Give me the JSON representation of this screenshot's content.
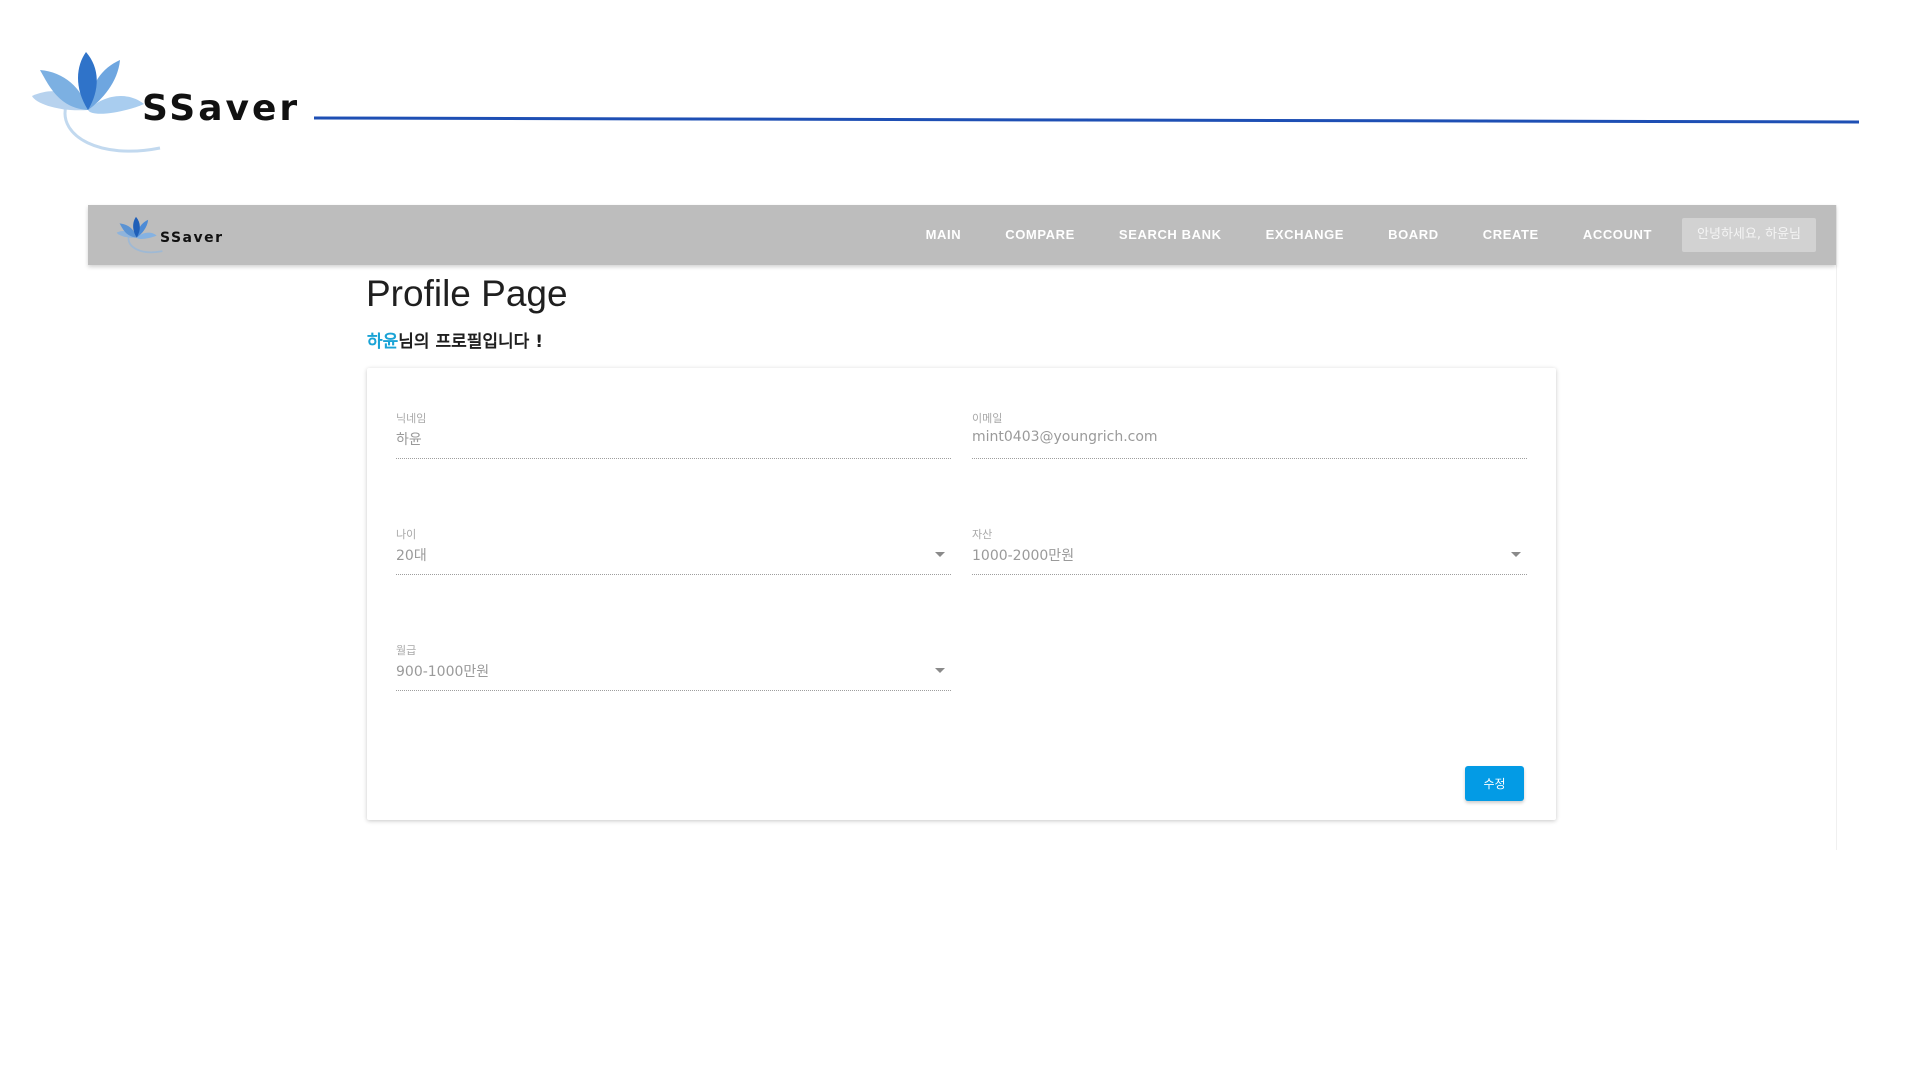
{
  "slide": {
    "logo_text": "SSaver"
  },
  "navbar": {
    "logo_text": "SSaver",
    "links": [
      "MAIN",
      "COMPARE",
      "SEARCH BANK",
      "EXCHANGE",
      "BOARD",
      "CREATE",
      "ACCOUNT"
    ],
    "greeting": "안녕하세요, 하윤님"
  },
  "page": {
    "title": "Profile Page",
    "subtitle_name": "하윤",
    "subtitle_rest": "님의 프로필입니다 !"
  },
  "form": {
    "nickname": {
      "label": "닉네임",
      "value": "하윤"
    },
    "email": {
      "label": "이메일",
      "value": "mint0403@youngrich.com"
    },
    "age": {
      "label": "나이",
      "value": "20대"
    },
    "asset": {
      "label": "자산",
      "value": "1000-2000만원"
    },
    "salary": {
      "label": "월급",
      "value": "900-1000만원"
    },
    "edit_button": "수정"
  },
  "colors": {
    "accent": "#039be5",
    "name_highlight": "#1aa3d6",
    "navbar_bg": "#bdbdbd",
    "divider_line": "#1e4fb4"
  }
}
